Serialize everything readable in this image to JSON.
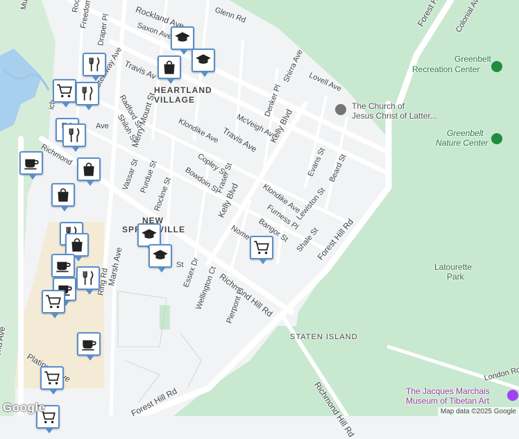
{
  "map": {
    "attribution": "Map data ©2025 Google",
    "logo": "Google",
    "colors": {
      "land": "#f1f3f4",
      "park": "#c8e8cf",
      "road": "#ffffff",
      "commercial": "#f4ebd6",
      "water": "#9fc6e8",
      "pin_border": "#5b8ec9"
    }
  },
  "streets": {
    "mulb": "Mulb",
    "rockland_short": "Rockl",
    "freedom_pl": "Freedom Pl",
    "rockland_ave": "Rockland Ave",
    "glenn_rd": "Glenn Rd",
    "forest_hill_top": "Forest Hill",
    "colonial_ave": "Colonial Ave",
    "draper_pl": "Draper Pl",
    "saxon_ave": "Saxon Ave",
    "travis_ave_1": "Travis Av",
    "steinway_ave": "Steinway Ave",
    "shirra_ave": "Shirra Ave",
    "lovell_ave": "Lovell Ave",
    "radford_st": "Radford St",
    "denker_pl": "Denker Pl",
    "shiloh_st": "Shiloh St",
    "mcveigh_ave": "McVeigh Ave",
    "klondike_ave_1": "Klondike Ave",
    "kelly_blvd_1": "Kelly Blvd",
    "travis_ave_2": "Travis Ave",
    "merry_mount_st": "Merry Mount St",
    "richmond_short": "Richmond",
    "ave_short": "Ave",
    "ich_short": "ich",
    "copley_st": "Copley St",
    "bowdoin_st": "Bowdoin St",
    "evans_st": "Evans St",
    "beard_st": "Beard St",
    "vassar_st": "Vassar St",
    "purdue_st": "Purdue St",
    "rockne_st": "Rockne St",
    "fraser_st": "Fraser St",
    "klondike_ave_2": "Klondike Ave",
    "kelly_blvd_2": "Kelly Blvd",
    "furness_pl": "Furness Pl",
    "lewiston_st": "Lewiston St",
    "nome_ave": "Nome",
    "bangor_st": "Bangor St",
    "shale_st": "Shale St",
    "forest_hill_rd_1": "Forest Hill Rd",
    "marsh_ave": "Marsh Ave",
    "ring_rd": "Ring Rd",
    "st_short": "St",
    "essex_dr": "Essex Dr",
    "wellington_ct": "Wellington Ct",
    "richmond_hill_rd_1": "Richmond Hill Rd",
    "pierpont_pl": "Pierpont Pl",
    "richmond_ave": "Richmond Ave",
    "platinum_ave": "Platinum Ave",
    "forest_hill_rd_2": "Forest Hill Rd",
    "richmond_hill_rd_2": "Richmond Hill Rd",
    "london_rd": "London Rd"
  },
  "areas": {
    "heartland_village_1": "HEARTLAND",
    "heartland_village_2": "VILLAGE",
    "new_springville_1": "NEW",
    "new_springville_2": "SPRINGVILLE",
    "staten_island": "STATEN ISLAND"
  },
  "places": {
    "greenbelt_rec_1": "Greenbelt",
    "greenbelt_rec_2": "Recreation Center",
    "church_1": "The Church of",
    "church_2": "Jesus Christ of Latter...",
    "greenbelt_nature_1": "Greenbelt",
    "greenbelt_nature_2": "Nature Center",
    "latourette_1": "Latourette",
    "latourette_2": "Park",
    "museum_1": "The Jacques Marchais",
    "museum_2": "Museum of Tibetan Art"
  },
  "pins": [
    {
      "icon": "school-icon"
    },
    {
      "icon": "shopping-bag-icon"
    },
    {
      "icon": "school-icon"
    },
    {
      "icon": "restaurant-icon"
    },
    {
      "icon": "shopping-cart-icon"
    },
    {
      "icon": "restaurant-icon"
    },
    {
      "icon": "restaurant-icon"
    },
    {
      "icon": "restaurant-icon"
    },
    {
      "icon": "cafe-icon"
    },
    {
      "icon": "shopping-bag-icon"
    },
    {
      "icon": "shopping-bag-icon"
    },
    {
      "icon": "school-icon"
    },
    {
      "icon": "school-icon"
    },
    {
      "icon": "restaurant-icon"
    },
    {
      "icon": "shopping-bag-icon"
    },
    {
      "icon": "cafe-icon"
    },
    {
      "icon": "cafe-icon"
    },
    {
      "icon": "restaurant-icon"
    },
    {
      "icon": "shopping-cart-icon"
    },
    {
      "icon": "shopping-cart-icon"
    },
    {
      "icon": "cafe-icon"
    },
    {
      "icon": "shopping-cart-icon"
    },
    {
      "icon": "shopping-cart-icon"
    }
  ]
}
